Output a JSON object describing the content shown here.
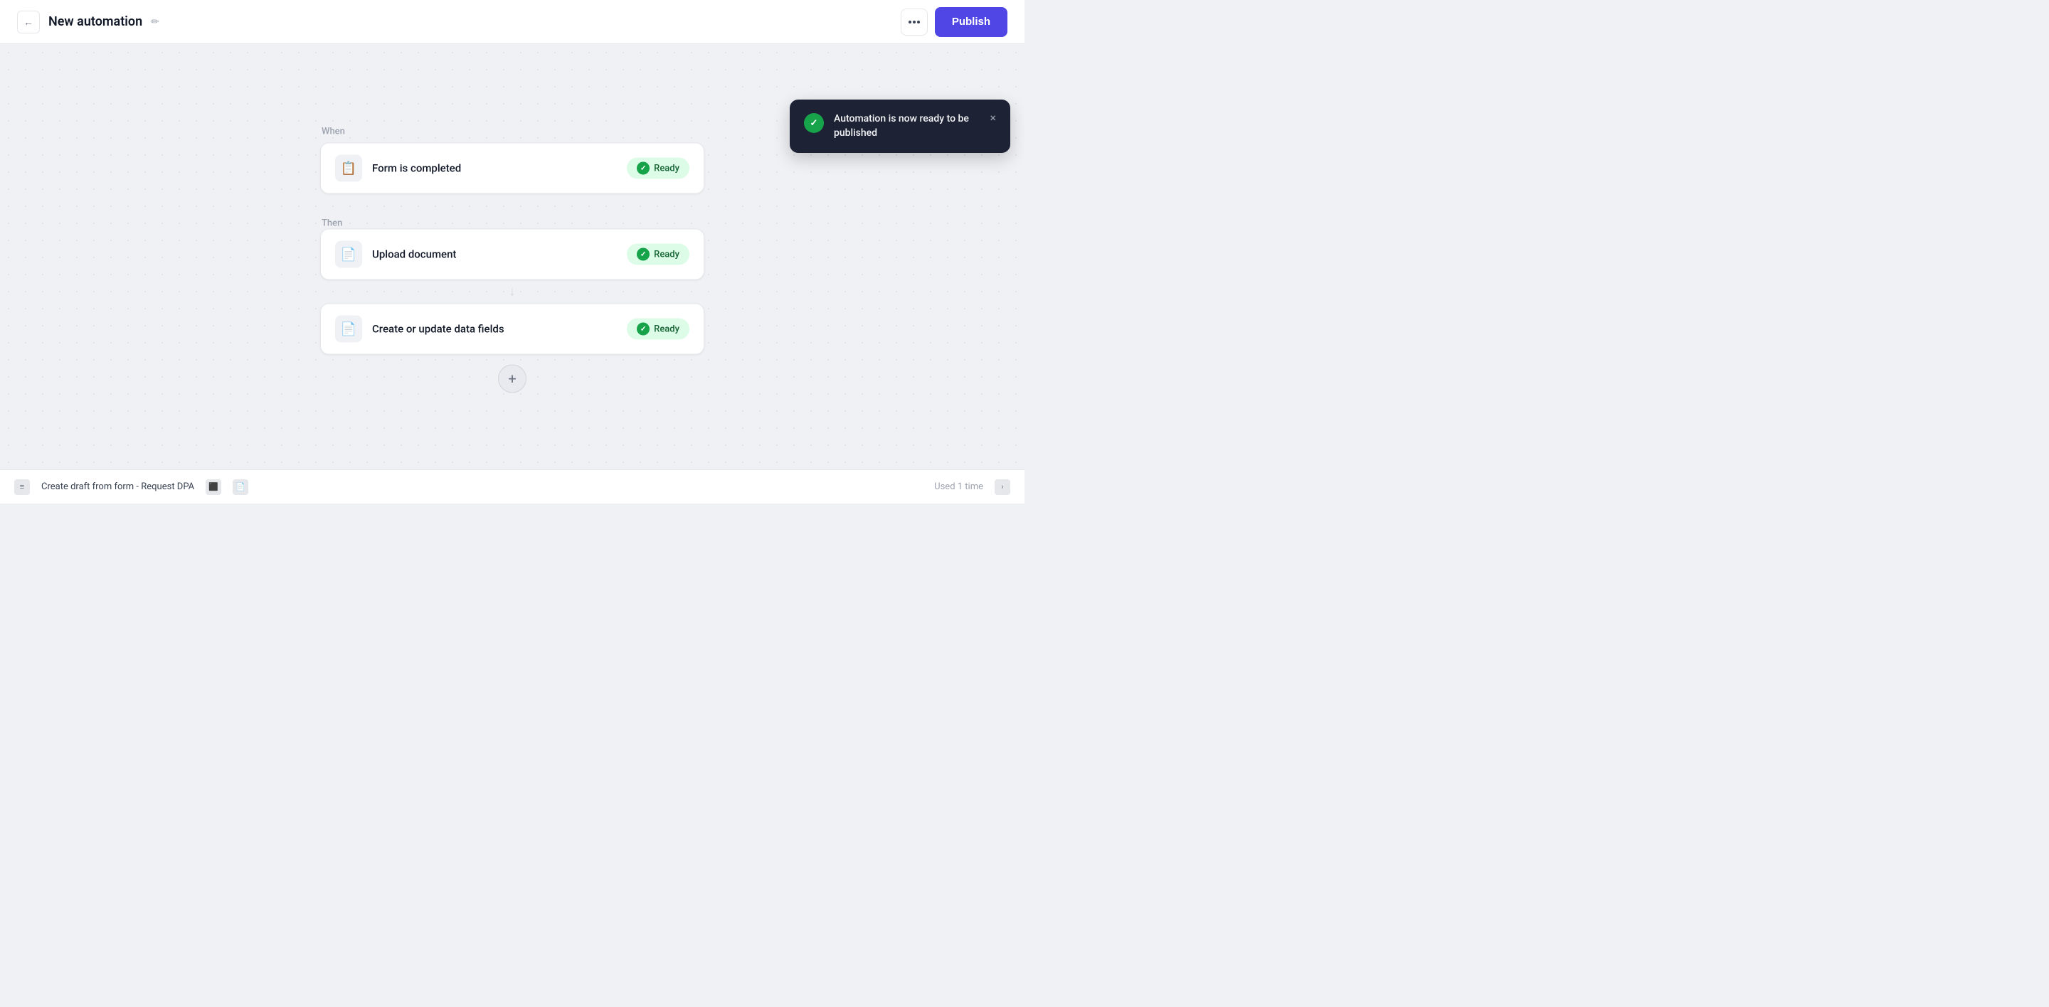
{
  "header": {
    "back_label": "←",
    "title": "New automation",
    "edit_icon": "✏",
    "more_label": "•••",
    "publish_label": "Publish"
  },
  "toast": {
    "message": "Automation is now ready to be published",
    "close_label": "×"
  },
  "flow": {
    "when_label": "When",
    "then_label": "Then",
    "steps": [
      {
        "id": "form-completed",
        "icon": "📋",
        "label": "Form is completed",
        "status": "Ready"
      },
      {
        "id": "upload-document",
        "icon": "📄",
        "label": "Upload document",
        "status": "Ready"
      },
      {
        "id": "create-update-fields",
        "icon": "📄",
        "label": "Create or update data fields",
        "status": "Ready"
      }
    ],
    "add_label": "+"
  },
  "bottom": {
    "text": "Create draft from form - Request DPA",
    "used_label": "Used 1 time"
  }
}
